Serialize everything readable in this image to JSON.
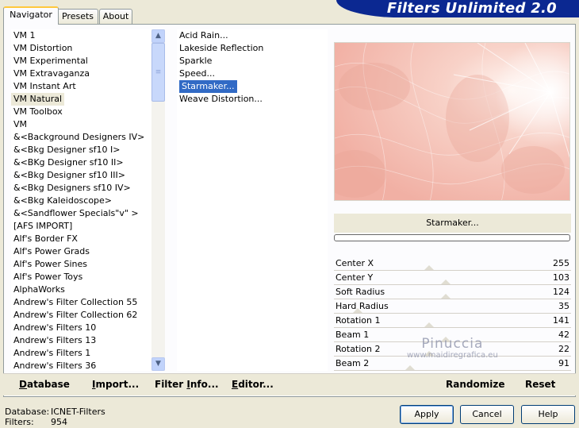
{
  "title": "Filters Unlimited 2.0",
  "tabs": [
    "Navigator",
    "Presets",
    "About"
  ],
  "categories": [
    "VM 1",
    "VM Distortion",
    "VM Experimental",
    "VM Extravaganza",
    "VM Instant Art",
    "VM Natural",
    "VM Toolbox",
    "VM",
    "&<Background Designers IV>",
    "&<Bkg Designer sf10 I>",
    "&<BKg Designer sf10 II>",
    "&<Bkg Designer sf10 III>",
    "&<Bkg Designers sf10 IV>",
    "&<Bkg Kaleidoscope>",
    "&<Sandflower Specials\"v\" >",
    "[AFS IMPORT]",
    "Alf's Border FX",
    "Alf's Power Grads",
    "Alf's Power Sines",
    "Alf's Power Toys",
    "AlphaWorks",
    "Andrew's Filter Collection 55",
    "Andrew's Filter Collection 62",
    "Andrew's Filters 10",
    "Andrew's Filters 13",
    "Andrew's Filters 1",
    "Andrew's Filters 36"
  ],
  "selected_category": "VM Natural",
  "filters": [
    "Acid Rain...",
    "Lakeside Reflection",
    "Sparkle",
    "Speed...",
    "Starmaker...",
    "Weave Distortion..."
  ],
  "selected_filter": "Starmaker...",
  "current_filter_name": "Starmaker...",
  "progress": 0,
  "parameters": [
    {
      "label": "Center X",
      "value": "255"
    },
    {
      "label": "Center Y",
      "value": "103"
    },
    {
      "label": "Soft Radius",
      "value": "124"
    },
    {
      "label": "Hard Radius",
      "value": "35"
    },
    {
      "label": "Rotation 1",
      "value": "141"
    },
    {
      "label": "Beam 1",
      "value": "42"
    },
    {
      "label": "Rotation 2",
      "value": "22"
    },
    {
      "label": "Beam 2",
      "value": "91"
    }
  ],
  "bottom_buttons": {
    "database": {
      "prefix": "",
      "underline": "D",
      "rest": "atabase"
    },
    "import": {
      "prefix": "",
      "underline": "I",
      "rest": "mport..."
    },
    "filter_info": {
      "prefix": "Filter ",
      "underline": "I",
      "rest": "nfo..."
    },
    "editor": {
      "prefix": "",
      "underline": "E",
      "rest": "ditor..."
    },
    "randomize": "Randomize",
    "reset": "Reset"
  },
  "status": {
    "database_label": "Database:",
    "database_value": "ICNET-Filters",
    "filters_label": "Filters:",
    "filters_value": "954"
  },
  "dialog_buttons": {
    "apply": "Apply",
    "cancel": "Cancel",
    "help": "Help"
  },
  "watermark": {
    "line1": "Pinuccia",
    "line2": "www.maidiregrafica.eu"
  },
  "colors": {
    "accent": "#0b2891",
    "selection": "#316ac5",
    "preview_tint": "#f5c6bd"
  },
  "icons": {
    "scroll_up": "chevron-up-icon",
    "scroll_down": "chevron-down-icon",
    "grip": "grip-icon"
  }
}
